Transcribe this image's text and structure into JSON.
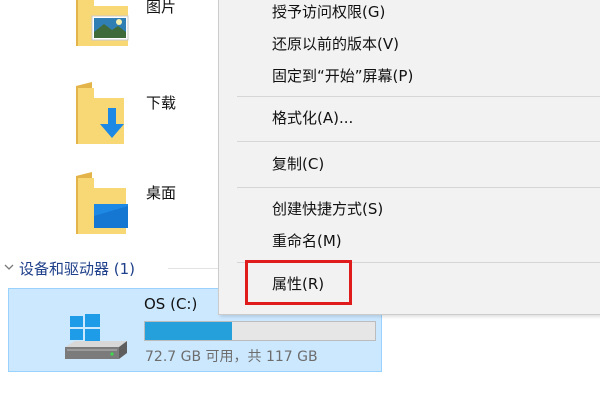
{
  "folders": [
    {
      "label": "图片",
      "icon": "pictures-folder-icon"
    },
    {
      "label": "下载",
      "icon": "downloads-folder-icon"
    },
    {
      "label": "桌面",
      "icon": "desktop-folder-icon"
    }
  ],
  "section": {
    "title": "设备和驱动器 (1)",
    "title_color": "#1e3f8a"
  },
  "drive": {
    "name": "OS (C:)",
    "used_fraction": 0.38,
    "size_text": "72.7 GB 可用，共 117 GB",
    "selection_color": "#cce8ff",
    "bar_color": "#26a0da"
  },
  "context_menu": {
    "items": [
      "授予访问权限(G)",
      "还原以前的版本(V)",
      "固定到“开始”屏幕(P)",
      "格式化(A)...",
      "复制(C)",
      "创建快捷方式(S)",
      "重命名(M)",
      "属性(R)"
    ],
    "highlighted_item": "属性(R)",
    "highlight_color": "#e01b1b"
  }
}
